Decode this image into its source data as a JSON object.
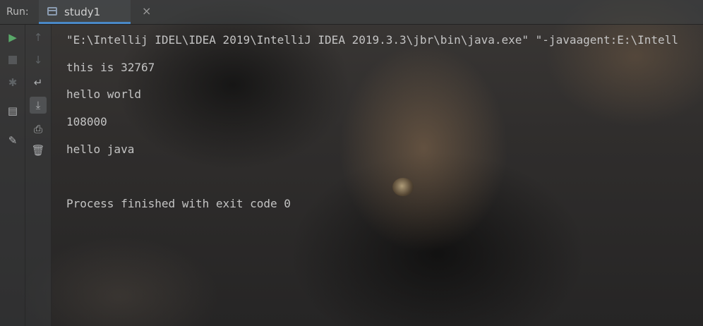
{
  "header": {
    "run_label": "Run:",
    "tab": {
      "label": "study1",
      "close": "×"
    }
  },
  "toolbar_left": [
    {
      "icon": "play-icon"
    },
    {
      "icon": "stop-icon"
    },
    {
      "icon": "debug-icon"
    },
    {
      "icon": "layout-icon"
    },
    {
      "icon": "pin-icon"
    }
  ],
  "toolbar_right": [
    {
      "icon": "arrow-up-icon"
    },
    {
      "icon": "arrow-down-icon"
    },
    {
      "icon": "soft-wrap-icon"
    },
    {
      "icon": "scroll-to-end-icon"
    },
    {
      "icon": "print-icon"
    },
    {
      "icon": "trash-icon"
    }
  ],
  "console": {
    "lines": [
      "\"E:\\Intellij IDEL\\IDEA 2019\\IntelliJ IDEA 2019.3.3\\jbr\\bin\\java.exe\" \"-javaagent:E:\\Intell",
      "this is 32767",
      "hello world",
      "108000",
      "hello java",
      "",
      "Process finished with exit code 0"
    ]
  },
  "colors": {
    "accent": "#4a88c7",
    "run_green": "#59a869"
  }
}
